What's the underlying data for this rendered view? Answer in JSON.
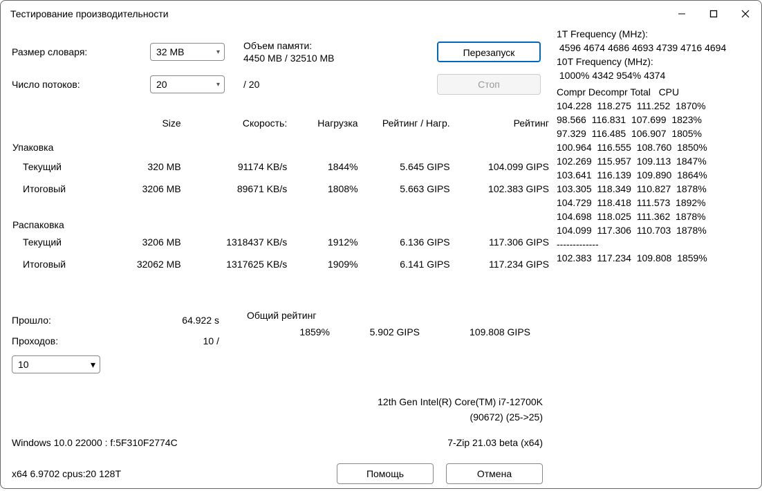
{
  "window": {
    "title": "Тестирование производительности"
  },
  "controls": {
    "dict_size_label": "Размер словаря:",
    "dict_size_value": "32 MB",
    "threads_label": "Число потоков:",
    "threads_value": "20",
    "threads_total": "/ 20",
    "mem_label": "Объем памяти:",
    "mem_value": "4450 MB / 32510 MB",
    "restart": "Перезапуск",
    "stop": "Стоп"
  },
  "headers": {
    "size": "Size",
    "speed": "Скорость:",
    "load": "Нагрузка",
    "rating_per_load": "Рейтинг / Нагр.",
    "rating": "Рейтинг"
  },
  "groups": {
    "pack": "Упаковка",
    "unpack": "Распаковка",
    "current": "Текущий",
    "total": "Итоговый"
  },
  "pack_current": {
    "size": "320 MB",
    "speed": "91174 KB/s",
    "load": "1844%",
    "rpl": "5.645 GIPS",
    "rating": "104.099 GIPS"
  },
  "pack_total": {
    "size": "3206 MB",
    "speed": "89671 KB/s",
    "load": "1808%",
    "rpl": "5.663 GIPS",
    "rating": "102.383 GIPS"
  },
  "unpack_current": {
    "size": "3206 MB",
    "speed": "1318437 KB/s",
    "load": "1912%",
    "rpl": "6.136 GIPS",
    "rating": "117.306 GIPS"
  },
  "unpack_total": {
    "size": "32062 MB",
    "speed": "1317625 KB/s",
    "load": "1909%",
    "rpl": "6.141 GIPS",
    "rating": "117.234 GIPS"
  },
  "elapsed": {
    "label": "Прошло:",
    "value": "64.922 s"
  },
  "passes": {
    "label": "Проходов:",
    "value": "10 /",
    "combo": "10"
  },
  "overall": {
    "label": "Общий рейтинг",
    "load": "1859%",
    "rpl": "5.902 GIPS",
    "rating": "109.808 GIPS"
  },
  "cpu_line1": "12th Gen Intel(R) Core(TM) i7-12700K",
  "cpu_line2": "(90672) (25->25)",
  "os_line": "Windows 10.0 22000 :  f:5F310F2774C",
  "zip_line": "7-Zip 21.03 beta (x64)",
  "arch_line": "x64 6.9702 cpus:20 128T",
  "help_btn": "Помощь",
  "cancel_btn": "Отмена",
  "log": {
    "f1_label": "1T Frequency (MHz):",
    "f1_values": " 4596 4674 4686 4693 4739 4716 4694",
    "f10_label": "10T Frequency (MHz):",
    "f10_values": " 1000% 4342 954% 4374",
    "columns": "Compr Decompr Total   CPU",
    "rows": [
      "104.228  118.275  111.252  1870%",
      "98.566  116.831  107.699  1823%",
      "97.329  116.485  106.907  1805%",
      "100.964  116.555  108.760  1850%",
      "102.269  115.957  109.113  1847%",
      "103.641  116.139  109.890  1864%",
      "103.305  118.349  110.827  1878%",
      "104.729  118.418  111.573  1892%",
      "104.698  118.025  111.362  1878%",
      "104.099  117.306  110.703  1878%"
    ],
    "sep": "-------------",
    "final": "102.383  117.234  109.808  1859%"
  }
}
